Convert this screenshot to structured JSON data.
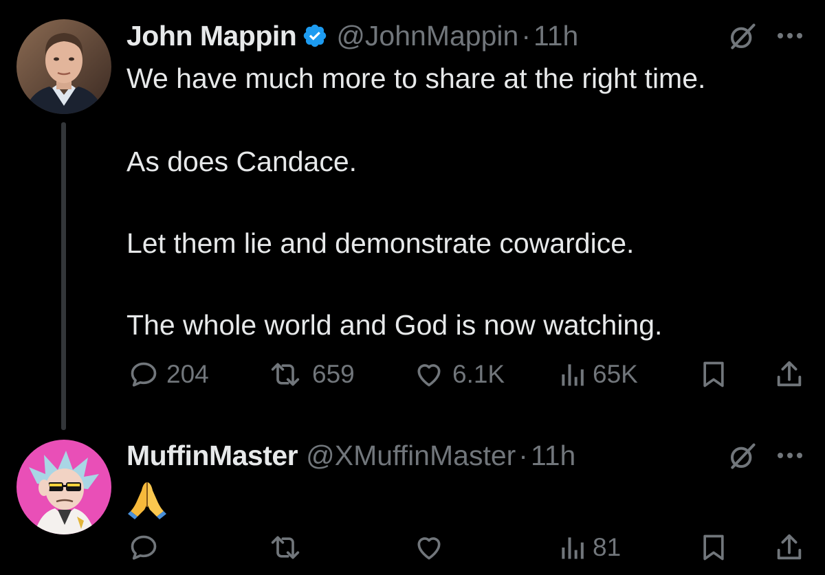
{
  "tweets": [
    {
      "author_name": "John Mappin",
      "verified": true,
      "handle": "@JohnMappin",
      "time": "11h",
      "separator": "·",
      "text_lines": [
        "We have much more to share at the right time.",
        "As does Candace.",
        "Let them lie and demonstrate cowardice.",
        "The whole world and God is now watching."
      ],
      "stats": {
        "replies": "204",
        "reposts": "659",
        "likes": "6.1K",
        "views": "65K"
      }
    },
    {
      "author_name": "MuffinMaster",
      "verified": false,
      "handle": "@XMuffinMaster",
      "time": "11h",
      "separator": "·",
      "content_emoji": "folded-hands-emoji",
      "stats": {
        "replies": "",
        "reposts": "",
        "likes": "",
        "views": "81"
      }
    }
  ],
  "colors": {
    "background": "#000000",
    "primary_text": "#e7e9ea",
    "secondary_text": "#71767b",
    "verified_blue": "#1d9bf0",
    "thread_line": "#333639"
  },
  "icons": {
    "reply": "reply-icon",
    "repost": "repost-icon",
    "like": "heart-icon",
    "views": "views-icon",
    "bookmark": "bookmark-icon",
    "share": "share-icon",
    "grok": "grok-icon",
    "more": "more-icon",
    "verified": "verified-badge-icon"
  }
}
